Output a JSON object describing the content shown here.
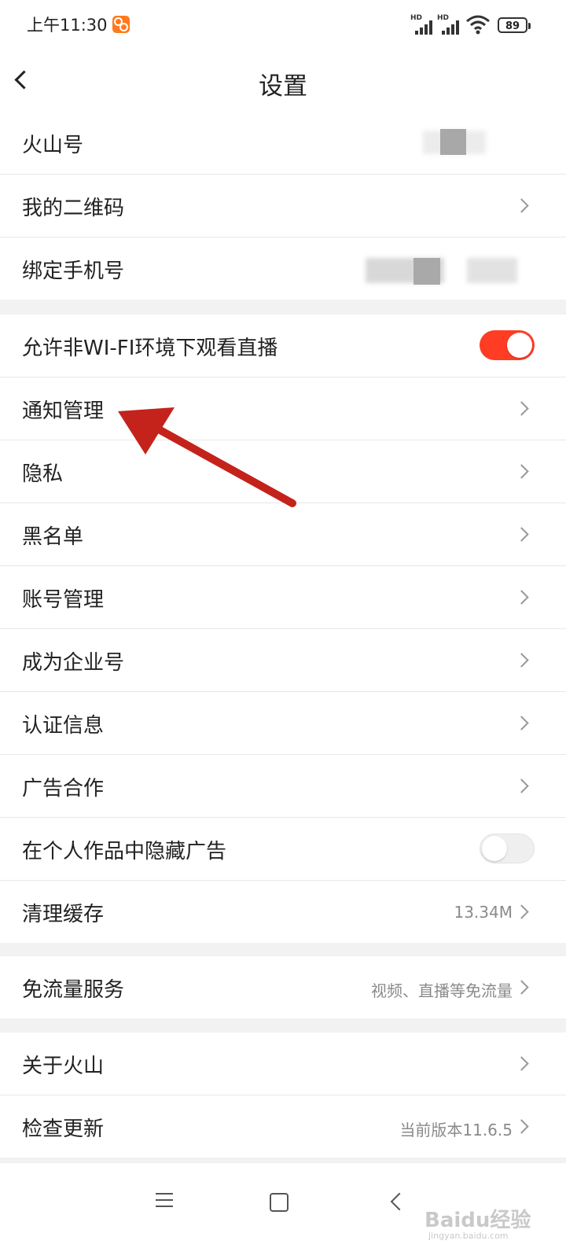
{
  "status_bar": {
    "time": "上午11:30",
    "signal_labels": [
      "HD",
      "HD"
    ],
    "battery": "89"
  },
  "header": {
    "title": "设置"
  },
  "sections": [
    {
      "items": [
        {
          "label": "火山号",
          "type": "value_hidden"
        },
        {
          "label": "我的二维码",
          "type": "chevron"
        },
        {
          "label": "绑定手机号",
          "type": "value_hidden"
        }
      ]
    },
    {
      "items": [
        {
          "label": "允许非WI-FI环境下观看直播",
          "type": "toggle",
          "toggle_on": true
        },
        {
          "label": "通知管理",
          "type": "chevron"
        },
        {
          "label": "隐私",
          "type": "chevron"
        },
        {
          "label": "黑名单",
          "type": "chevron"
        },
        {
          "label": "账号管理",
          "type": "chevron"
        },
        {
          "label": "成为企业号",
          "type": "chevron"
        },
        {
          "label": "认证信息",
          "type": "chevron"
        },
        {
          "label": "广告合作",
          "type": "chevron"
        },
        {
          "label": "在个人作品中隐藏广告",
          "type": "toggle",
          "toggle_on": false
        },
        {
          "label": "清理缓存",
          "type": "value_chevron",
          "value": "13.34M"
        }
      ]
    },
    {
      "items": [
        {
          "label": "免流量服务",
          "type": "value_chevron",
          "value": "视频、直播等免流量"
        }
      ]
    },
    {
      "items": [
        {
          "label": "关于火山",
          "type": "chevron"
        },
        {
          "label": "检查更新",
          "type": "value_chevron",
          "value": "当前版本11.6.5"
        }
      ]
    }
  ],
  "watermark": {
    "text": "Baidu经验",
    "url": "jingyan.baidu.com"
  },
  "colors": {
    "accent": "#ff3c24",
    "annotation_arrow": "#c4231b"
  }
}
